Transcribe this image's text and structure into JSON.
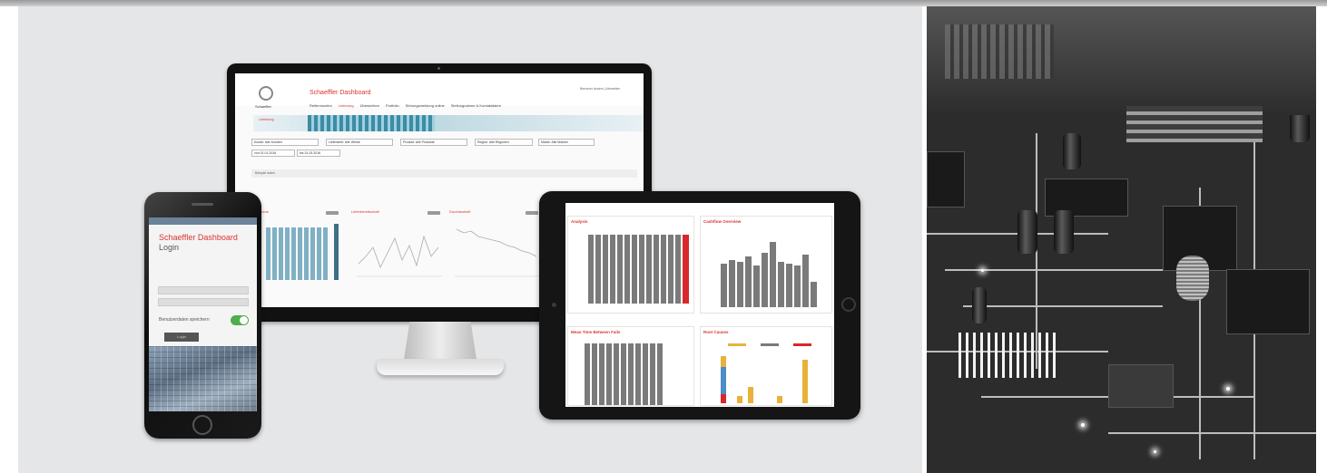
{
  "desktop_dashboard": {
    "logo_text": "Schaeffler",
    "title": "Schaeffler Dashboard",
    "header_links": "Benutzer ändern | Abmelden",
    "nav": [
      "Reifenmonitor",
      "Lieferung",
      "Übersichten",
      "Portfolio",
      "Störungsmeldung online",
      "Stellungnahme & Kontaktdaten"
    ],
    "active_nav_index": 1,
    "banner_label": "Lieferung",
    "filters": [
      {
        "label": "Kunde",
        "value": "Alle Kunden"
      },
      {
        "label": "Lieferwerk",
        "value": "Alle Werke"
      },
      {
        "label": "Produkt",
        "value": "Alle Produkte"
      },
      {
        "label": "Region",
        "value": "Alle Regionen"
      },
      {
        "label": "Marke",
        "value": "Alle Marken"
      },
      {
        "label": "von",
        "value": "01.01.2016"
      },
      {
        "label": "bis",
        "value": "31.03.2016"
      }
    ],
    "info_text": "Beispiel daten",
    "chart_titles": [
      "Liefertreue",
      "Lieferbereitschaft",
      "Durchlaufzeit"
    ]
  },
  "phone_app": {
    "title": "Schaeffler Dashboard",
    "subtitle": "Login",
    "remember_label": "Benutzerdaten speichern",
    "login_button": "Login"
  },
  "tablet_dashboard": {
    "panel_titles": [
      "Analysis",
      "Cashflow Overview",
      "Mean Time Between Fails",
      "Root Causes"
    ]
  },
  "colors": {
    "brand_red": "#d33333",
    "panel_bg": "#e5e6e8",
    "bar_gray": "#7a7a7a",
    "bar_teal": "#7fb0c3"
  }
}
